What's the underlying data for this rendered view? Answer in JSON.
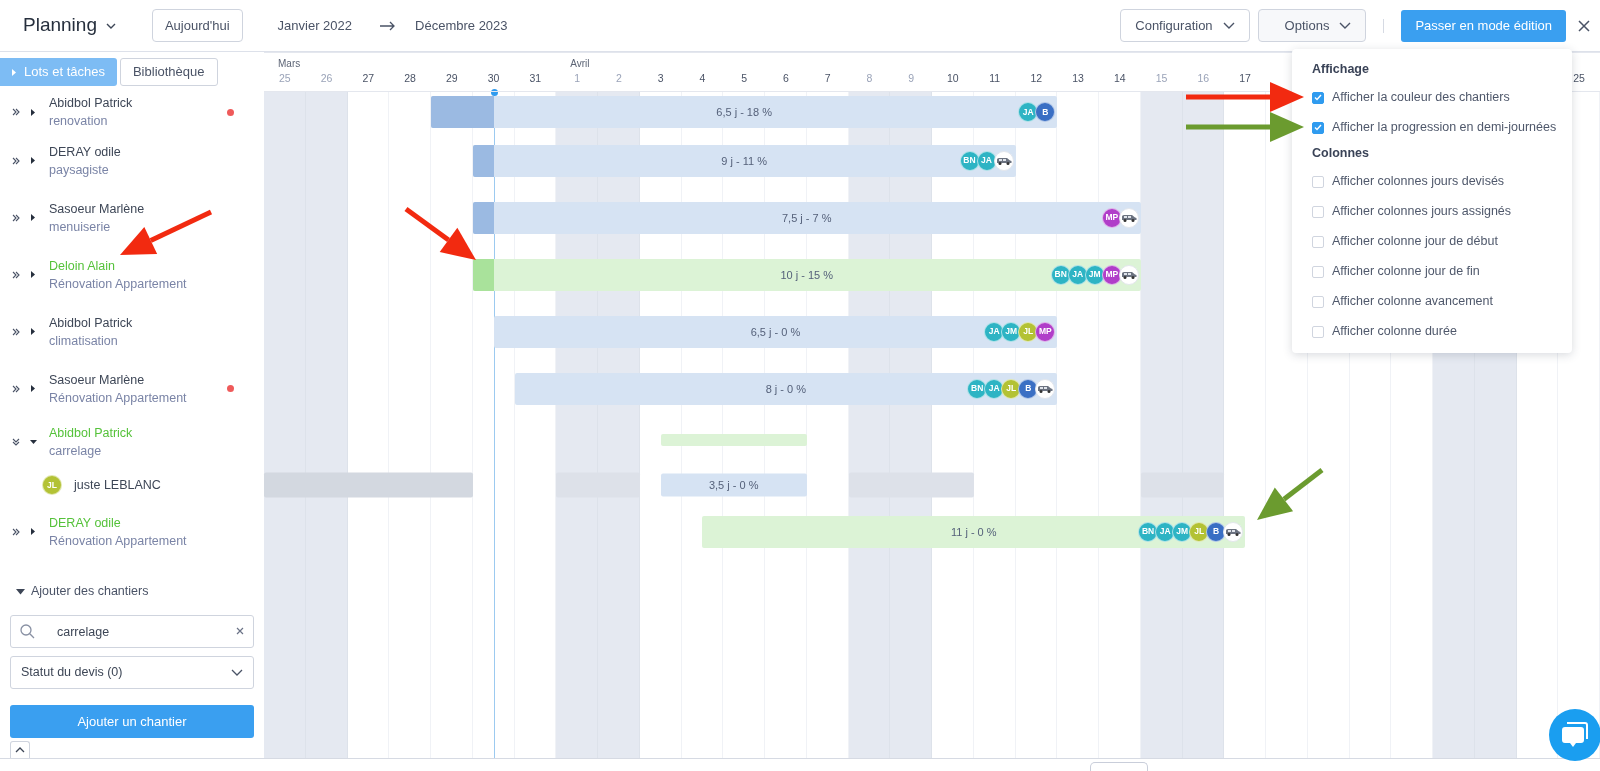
{
  "topbar": {
    "title": "Planning",
    "today_button": "Aujourd'hui",
    "range_start": "Janvier 2022",
    "range_end": "Décembre 2023",
    "menus": [
      {
        "label": "Configuration",
        "expanded": false
      },
      {
        "label": "Options",
        "expanded": true
      }
    ],
    "edit_button": "Passer en mode édition"
  },
  "sidebar": {
    "tabs": [
      {
        "label": "Lots et tâches",
        "selected": true
      },
      {
        "label": "Bibliothèque",
        "selected": false
      }
    ]
  },
  "timeline": {
    "months": [
      {
        "label": "Mars"
      },
      {
        "label": "Avril"
      }
    ],
    "days": [
      {
        "label": "25",
        "weekend": true
      },
      {
        "label": "26",
        "weekend": true
      },
      {
        "label": "27",
        "weekend": false
      },
      {
        "label": "28",
        "weekend": false
      },
      {
        "label": "29",
        "weekend": false
      },
      {
        "label": "30",
        "weekend": false
      },
      {
        "label": "31",
        "weekend": false
      },
      {
        "label": "1",
        "weekend": true
      },
      {
        "label": "2",
        "weekend": true
      },
      {
        "label": "3",
        "weekend": false
      },
      {
        "label": "4",
        "weekend": false
      },
      {
        "label": "5",
        "weekend": false
      },
      {
        "label": "6",
        "weekend": false
      },
      {
        "label": "7",
        "weekend": false
      },
      {
        "label": "8",
        "weekend": true
      },
      {
        "label": "9",
        "weekend": true
      },
      {
        "label": "10",
        "weekend": false
      },
      {
        "label": "11",
        "weekend": false
      },
      {
        "label": "12",
        "weekend": false
      },
      {
        "label": "13",
        "weekend": false
      },
      {
        "label": "14",
        "weekend": false
      },
      {
        "label": "15",
        "weekend": true
      },
      {
        "label": "16",
        "weekend": true
      },
      {
        "label": "17",
        "weekend": false
      },
      {
        "weekend": false
      },
      {
        "weekend": false
      },
      {
        "weekend": false
      },
      {
        "weekend": false
      },
      {
        "weekend": true
      },
      {
        "weekend": true
      },
      {
        "weekend": false
      },
      {
        "label": "25",
        "weekend": false
      }
    ]
  },
  "rows": [
    {
      "name": "Abidbol Patrick",
      "subtitle": "renovation",
      "highlighted": false,
      "expanded": false,
      "alert": true,
      "bar": {
        "kind": "task",
        "label": "6,5 j - 18 %",
        "color": "#d6e3f3",
        "avatars": [
          {
            "kind": "initials",
            "initials": "JA",
            "color": "#2db4c4"
          },
          {
            "kind": "initials",
            "initials": "B",
            "color": "#3a6fc4"
          }
        ]
      }
    },
    {
      "name": "DERAY odile",
      "subtitle": "paysagiste",
      "highlighted": false,
      "expanded": false,
      "alert": false,
      "bar": {
        "kind": "task",
        "label": "9 j - 11 %",
        "color": "#d6e3f3",
        "avatars": [
          {
            "kind": "initials",
            "initials": "BN",
            "color": "#2db4c4"
          },
          {
            "kind": "initials",
            "initials": "JA",
            "color": "#2db4c4"
          },
          {
            "kind": "vehicle"
          }
        ]
      }
    },
    {
      "name": "Sasoeur Marlène",
      "subtitle": "menuiserie",
      "highlighted": false,
      "expanded": false,
      "alert": false,
      "bar": {
        "kind": "task",
        "label": "7,5 j - 7 %",
        "color": "#d6e3f3",
        "avatars": [
          {
            "kind": "initials",
            "initials": "MP",
            "color": "#b03ec9"
          },
          {
            "kind": "vehicle"
          }
        ]
      }
    },
    {
      "name": "Deloin Alain",
      "subtitle": "Rénovation Appartement",
      "highlighted": true,
      "expanded": false,
      "alert": false,
      "bar": {
        "kind": "task",
        "label": "10 j - 15 %",
        "color": "#dcf3d6",
        "avatars": [
          {
            "kind": "initials",
            "initials": "BN",
            "color": "#2db4c4"
          },
          {
            "kind": "initials",
            "initials": "JA",
            "color": "#2db4c4"
          },
          {
            "kind": "initials",
            "initials": "JM",
            "color": "#2db4c4"
          },
          {
            "kind": "initials",
            "initials": "MP",
            "color": "#b03ec9"
          },
          {
            "kind": "vehicle"
          }
        ]
      }
    },
    {
      "name": "Abidbol Patrick",
      "subtitle": "climatisation",
      "highlighted": false,
      "expanded": false,
      "alert": false,
      "bar": {
        "kind": "task",
        "label": "6,5 j - 0 %",
        "color": "#d6e3f3",
        "avatars": [
          {
            "kind": "initials",
            "initials": "JA",
            "color": "#2db4c4"
          },
          {
            "kind": "initials",
            "initials": "JM",
            "color": "#2db4c4"
          },
          {
            "kind": "initials",
            "initials": "JL",
            "color": "#b3c235"
          },
          {
            "kind": "initials",
            "initials": "MP",
            "color": "#b03ec9"
          }
        ]
      }
    },
    {
      "name": "Sasoeur Marlène",
      "subtitle": "Rénovation Appartement",
      "highlighted": false,
      "expanded": false,
      "alert": true,
      "bar": {
        "kind": "task",
        "label": "8 j - 0 %",
        "color": "#d6e3f3",
        "avatars": [
          {
            "kind": "initials",
            "initials": "BN",
            "color": "#2db4c4"
          },
          {
            "kind": "initials",
            "initials": "JA",
            "color": "#2db4c4"
          },
          {
            "kind": "initials",
            "initials": "JL",
            "color": "#b3c235"
          },
          {
            "kind": "initials",
            "initials": "B",
            "color": "#3a6fc4"
          },
          {
            "kind": "vehicle"
          }
        ]
      }
    },
    {
      "name": "Abidbol Patrick",
      "subtitle": "carrelage",
      "highlighted": true,
      "expanded": true,
      "alert": false,
      "bar": {
        "kind": "summary",
        "color": "#dcf3d6"
      },
      "children": [
        {
          "name": "juste LEBLANC",
          "initials": "JL",
          "color": "#b3c235",
          "blocks": [
            {
              "kind": "absence"
            },
            {
              "kind": "off"
            },
            {
              "kind": "off"
            },
            {
              "kind": "off"
            }
          ],
          "bar": {
            "kind": "assignment",
            "label": "3,5 j - 0 %",
            "color": "#d6e3f3"
          }
        }
      ]
    },
    {
      "name": "DERAY odile",
      "subtitle": "Rénovation Appartement",
      "highlighted": true,
      "expanded": false,
      "alert": false,
      "bar": {
        "kind": "task",
        "label": "11 j - 0 %",
        "color": "#dcf3d6",
        "avatars": [
          {
            "kind": "initials",
            "initials": "BN",
            "color": "#2db4c4"
          },
          {
            "kind": "initials",
            "initials": "JA",
            "color": "#2db4c4"
          },
          {
            "kind": "initials",
            "initials": "JM",
            "color": "#2db4c4"
          },
          {
            "kind": "initials",
            "initials": "JL",
            "color": "#b3c235"
          },
          {
            "kind": "initials",
            "initials": "B",
            "color": "#3a6fc4"
          },
          {
            "kind": "vehicle"
          }
        ]
      }
    }
  ],
  "add_section": {
    "title": "Ajouter des chantiers",
    "expanded": true,
    "search_value": "carrelage",
    "status_select": "Statut du devis (0)",
    "add_button": "Ajouter un chantier"
  },
  "options_menu": {
    "sections": [
      {
        "title": "Affichage",
        "items": [
          {
            "label": "Afficher la couleur des chantiers",
            "checked": true
          },
          {
            "label": "Afficher la progression en demi-journées",
            "checked": true
          }
        ]
      },
      {
        "title": "Colonnes",
        "items": [
          {
            "label": "Afficher colonnes jours devisés",
            "checked": false
          },
          {
            "label": "Afficher colonnes jours assignés",
            "checked": false
          },
          {
            "label": "Afficher colonne jour de début",
            "checked": false
          },
          {
            "label": "Afficher colonne jour de fin",
            "checked": false
          },
          {
            "label": "Afficher colonne avancement",
            "checked": false
          },
          {
            "label": "Afficher colonne durée",
            "checked": false
          }
        ]
      }
    ]
  },
  "annotations": [
    {
      "color": "#f22a10"
    },
    {
      "color": "#6b9b2f"
    },
    {
      "color": "#f22a10"
    },
    {
      "color": "#f22a10"
    },
    {
      "color": "#6b9b2f"
    }
  ]
}
